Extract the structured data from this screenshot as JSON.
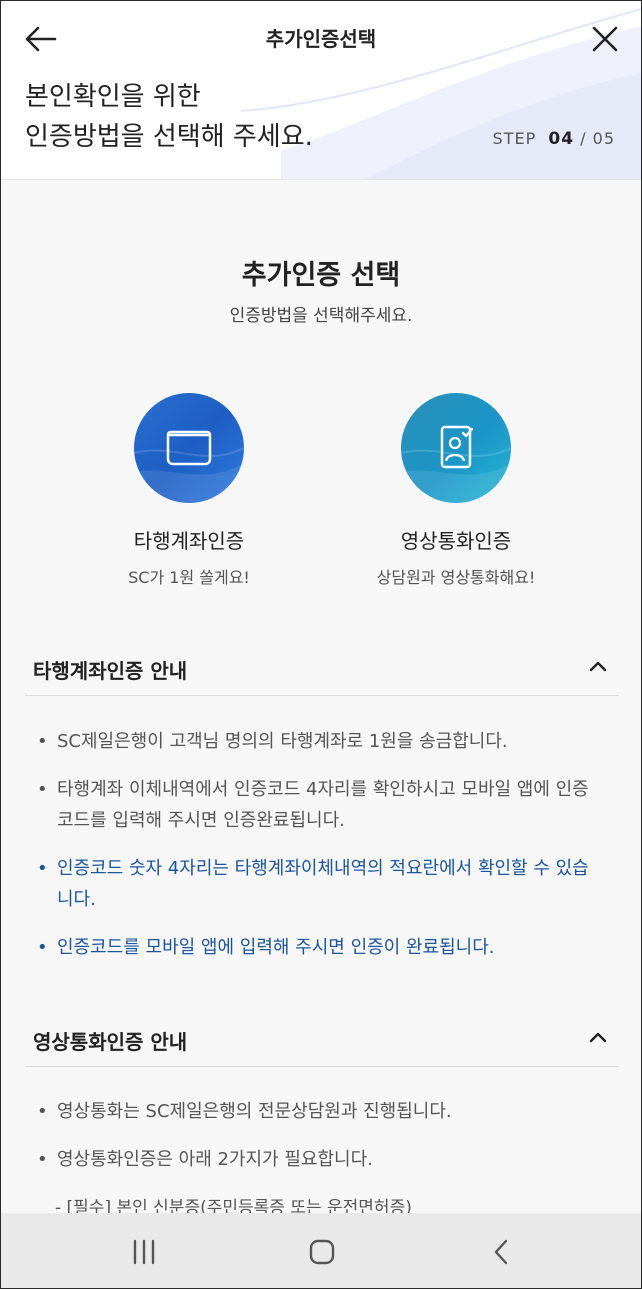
{
  "header": {
    "title": "추가인증선택",
    "headline_line1": "본인확인을 위한",
    "headline_line2": "인증방법을 선택해 주세요.",
    "step_label": "STEP",
    "step_current": "04",
    "step_sep": "/",
    "step_total": "05"
  },
  "main": {
    "title": "추가인증 선택",
    "subtitle": "인증방법을 선택해주세요.",
    "options": [
      {
        "label": "타행계좌인증",
        "desc": "SC가 1원 쏠게요!",
        "icon": "wallet-icon",
        "color": "#2a6fd0"
      },
      {
        "label": "영상통화인증",
        "desc": "상담원과 영상통화해요!",
        "icon": "id-card-check-icon",
        "color": "#1b95c8"
      }
    ]
  },
  "accordions": [
    {
      "title": "타행계좌인증 안내",
      "items": [
        {
          "text": "SC제일은행이 고객님 명의의 타행계좌로 1원을 송금합니다."
        },
        {
          "text": "타행계좌 이체내역에서 인증코드 4자리를 확인하시고 모바일 앱에 인증코드를 입력해 주시면 인증완료됩니다."
        },
        {
          "text": "인증코드 숫자 4자리는 타행계좌이체내역의 적요란에서 확인할 수 있습니다."
        },
        {
          "text": "인증코드를 모바일 앱에 입력해 주시면 인증이 완료됩니다."
        }
      ]
    },
    {
      "title": "영상통화인증 안내",
      "items": [
        {
          "text": "영상통화는 SC제일은행의 전문상담원과 진행됩니다."
        },
        {
          "text": "영상통화인증은 아래 2가지가 필요합니다."
        }
      ],
      "sub_items": [
        "- [필수] 본인 신분증(주민등록증 또는 운전면허증)"
      ]
    }
  ],
  "colors": {
    "accent_blue": "#1a55a0",
    "icon_blue": "#2a6fd0",
    "icon_teal": "#1b95c8"
  },
  "navbar": {
    "icons": [
      "recent-apps-icon",
      "home-icon",
      "back-nav-icon"
    ]
  }
}
